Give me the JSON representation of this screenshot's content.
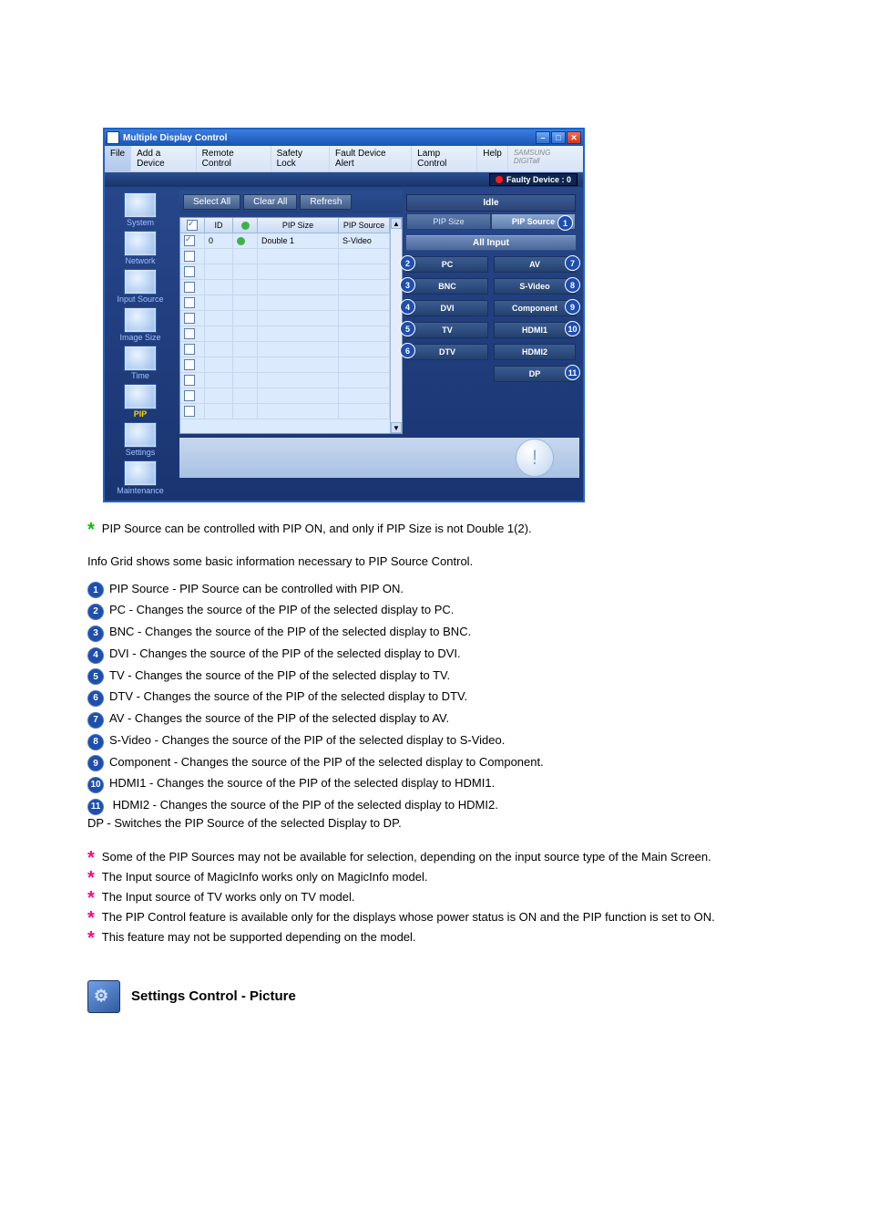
{
  "titlebar": {
    "title": "Multiple Display Control"
  },
  "winbtns": {
    "min": "–",
    "max": "□",
    "close": "✕"
  },
  "menu": {
    "file": "File",
    "add": "Add a Device",
    "remote": "Remote Control",
    "safety": "Safety Lock",
    "fault": "Fault Device Alert",
    "lamp": "Lamp Control",
    "help": "Help",
    "brand": "SAMSUNG DIGITall"
  },
  "faulty": {
    "label": "Faulty Device : 0"
  },
  "sidebar": {
    "system": "System",
    "network": "Network",
    "input": "Input Source",
    "image": "Image Size",
    "time": "Time",
    "pip": "PIP",
    "settings": "Settings",
    "maint": "Maintenance"
  },
  "toolbar": {
    "selectall": "Select All",
    "clearall": "Clear All",
    "refresh": "Refresh"
  },
  "grid": {
    "head": {
      "chk": "",
      "id": "ID",
      "stat": "",
      "pipsize": "PIP Size",
      "pipsrc": "PIP Source"
    },
    "row0": {
      "id": "0",
      "pipsize": "Double 1",
      "pipsrc": "S-Video"
    }
  },
  "right": {
    "idle": "Idle",
    "tabs": {
      "size": "PIP Size",
      "src": "PIP Source"
    },
    "allinput": "All Input",
    "btns": {
      "pc": "PC",
      "av": "AV",
      "bnc": "BNC",
      "svideo": "S-Video",
      "dvi": "DVI",
      "component": "Component",
      "tv": "TV",
      "hdmi1": "HDMI1",
      "dtv": "DTV",
      "hdmi2": "HDMI2",
      "dp": "DP"
    },
    "nums": {
      "n1": "1",
      "n2": "2",
      "n3": "3",
      "n4": "4",
      "n5": "5",
      "n6": "6",
      "n7": "7",
      "n8": "8",
      "n9": "9",
      "n10": "10",
      "n11": "11"
    }
  },
  "doc": {
    "green_note": "PIP Source can be controlled with PIP ON, and only if PIP Size is not Double 1(2).",
    "info": "Info Grid shows some basic information necessary to PIP Source Control.",
    "l1": "PIP Source - PIP Source can be controlled with PIP ON.",
    "l2": "PC - Changes the source of the PIP of the selected display to PC.",
    "l3": "BNC - Changes the source of the PIP of the selected display to BNC.",
    "l4": "DVI - Changes the source of the PIP of the selected display to DVI.",
    "l5": "TV - Changes the source of the PIP of the selected display to TV.",
    "l6": "DTV - Changes the source of the PIP of the selected display to DTV.",
    "l7": "AV - Changes the source of the PIP of the selected display to AV.",
    "l8": "S-Video - Changes the source of the PIP of the selected display to S-Video.",
    "l9": "Component - Changes the source of the PIP of the selected display to Component.",
    "l10": "HDMI1 - Changes the source of the PIP of the selected display to HDMI1.",
    "l11": " HDMI2 - Changes the source of the PIP of the selected display to HDMI2.\n DP - Switches the PIP Source of the selected Display to DP.",
    "r1": "Some of the PIP Sources may not be available for selection, depending on the input source type of the Main Screen.",
    "r2": "The Input source of MagicInfo works only on MagicInfo model.",
    "r3": "The Input source of TV works only on TV model.",
    "r4": "The PIP Control feature is available only for the displays whose power status is ON and the PIP function is set to ON.",
    "r5": "This feature may not be supported depending on the model.",
    "settings_head": "Settings Control - Picture"
  }
}
